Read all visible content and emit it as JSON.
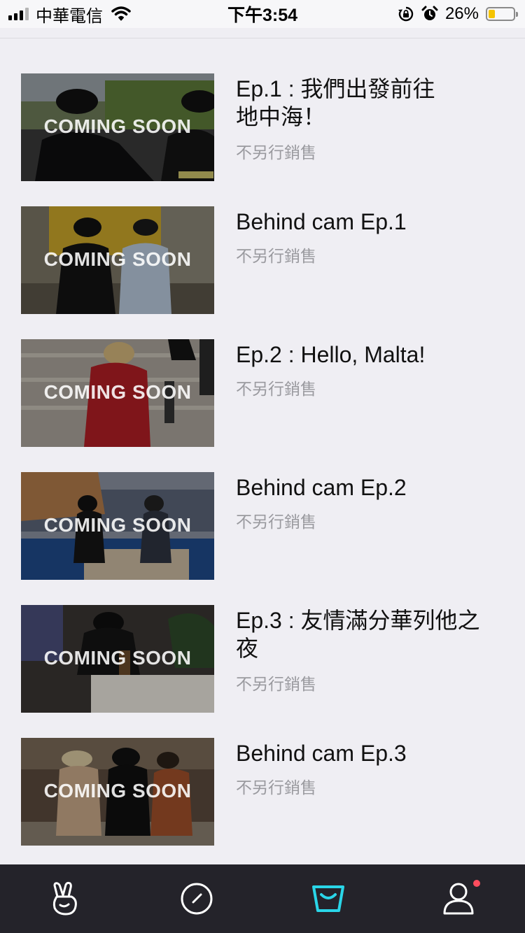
{
  "status_bar": {
    "carrier": "中華電信",
    "time": "下午3:54",
    "battery_percent_label": "26%",
    "battery_level": 0.26
  },
  "episodes": [
    {
      "title": "Ep.1 : 我們出發前往地中海！",
      "badge": "COMING SOON",
      "subtitle": "不另行銷售"
    },
    {
      "title": "Behind cam Ep.1",
      "badge": "COMING SOON",
      "subtitle": "不另行銷售"
    },
    {
      "title": "Ep.2 : Hello, Malta!",
      "badge": "COMING SOON",
      "subtitle": "不另行銷售"
    },
    {
      "title": "Behind cam Ep.2",
      "badge": "COMING SOON",
      "subtitle": "不另行銷售"
    },
    {
      "title": "Ep.3 : 友情滿分華列他之夜",
      "badge": "COMING SOON",
      "subtitle": "不另行銷售"
    },
    {
      "title": "Behind cam Ep.3",
      "badge": "COMING SOON",
      "subtitle": "不另行銷售"
    }
  ],
  "tabbar": {
    "tabs": [
      {
        "icon": "vlive-hand-icon",
        "active": false
      },
      {
        "icon": "compass-icon",
        "active": false
      },
      {
        "icon": "store-basket-icon",
        "active": true
      },
      {
        "icon": "profile-icon",
        "active": false,
        "has_notification_dot": true
      }
    ],
    "active_color": "#2ad6e8",
    "inactive_color": "#ffffff",
    "notification_color": "#ff4d5e"
  }
}
